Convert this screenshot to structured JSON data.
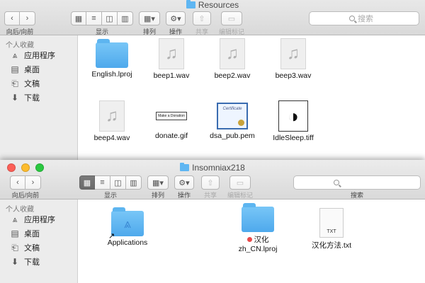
{
  "windows": [
    {
      "title": "Resources",
      "nav_label": "向后/向前",
      "view_label": "显示",
      "arrange_label": "排列",
      "action_label": "操作",
      "share_label": "共享",
      "tags_label": "编辑标记",
      "search_placeholder": "搜索",
      "search_label": "",
      "sidebar": {
        "section": "个人收藏",
        "items": [
          {
            "label": "应用程序",
            "icon": "applications-icon"
          },
          {
            "label": "桌面",
            "icon": "desktop-icon"
          },
          {
            "label": "文稿",
            "icon": "documents-icon"
          },
          {
            "label": "下载",
            "icon": "downloads-icon"
          }
        ]
      },
      "files": [
        {
          "name": "English.lproj",
          "kind": "folder"
        },
        {
          "name": "beep1.wav",
          "kind": "audio"
        },
        {
          "name": "beep2.wav",
          "kind": "audio"
        },
        {
          "name": "beep3.wav",
          "kind": "audio"
        },
        {
          "name": "beep4.wav",
          "kind": "audio"
        },
        {
          "name": "donate.gif",
          "kind": "gif",
          "thumb_text": "Make a Donation"
        },
        {
          "name": "dsa_pub.pem",
          "kind": "certificate",
          "thumb_text": "Certificate"
        },
        {
          "name": "IdleSleep.tiff",
          "kind": "image"
        }
      ]
    },
    {
      "title": "Insomniax218",
      "nav_label": "向后/向前",
      "view_label": "显示",
      "arrange_label": "排列",
      "action_label": "操作",
      "share_label": "共享",
      "tags_label": "编辑标记",
      "search_placeholder": "",
      "search_label": "搜索",
      "sidebar": {
        "section": "个人收藏",
        "items": [
          {
            "label": "应用程序",
            "icon": "applications-icon"
          },
          {
            "label": "桌面",
            "icon": "desktop-icon"
          },
          {
            "label": "文稿",
            "icon": "documents-icon"
          },
          {
            "label": "下载",
            "icon": "downloads-icon"
          }
        ]
      },
      "files": [
        {
          "name": "Applications",
          "kind": "folder-alias"
        },
        {
          "name": "汉化",
          "name2": "zh_CN.lproj",
          "kind": "folder",
          "tag_color": "#e84a4a"
        },
        {
          "name": "汉化方法.txt",
          "kind": "text",
          "thumb_text": "TXT"
        }
      ]
    }
  ]
}
